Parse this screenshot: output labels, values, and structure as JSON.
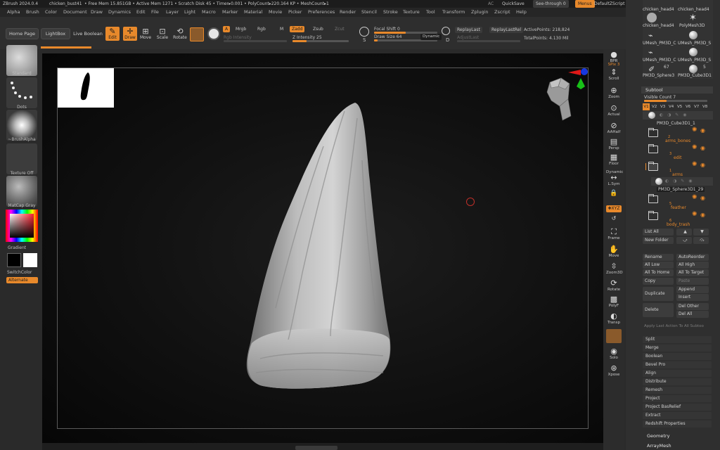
{
  "titlebar": {
    "app": "ZBrush 2024.0.4",
    "file": "chicken_bust41",
    "stats": "• Free Mem 15.851GB • Active Mem 1271 • Scratch Disk 45 • Timer▸0.001 • PolyCount▸220.164 KP • MeshCount▸1",
    "ac": "AC",
    "quicksave": "QuickSave",
    "see_through": "See-through   0",
    "menus": "Menus",
    "zscript": "DefaultZScript"
  },
  "menubar": [
    "Alpha",
    "Brush",
    "Color",
    "Document",
    "Draw",
    "Dynamics",
    "Edit",
    "File",
    "Layer",
    "Light",
    "Macro",
    "Marker",
    "Material",
    "Movie",
    "Picker",
    "Preferences",
    "Render",
    "Stencil",
    "Stroke",
    "Texture",
    "Tool",
    "Transform",
    "Zplugin",
    "Zscript",
    "Help"
  ],
  "toolbar": {
    "home_page": "Home Page",
    "lightbox": "LightBox",
    "live_boolean": "Live Boolean",
    "edit": "Edit",
    "draw": "Draw",
    "move": "Move",
    "scale": "Scale",
    "rotate": "Rotate",
    "a": "A",
    "mrgb": "Mrgb",
    "rgb": "Rgb",
    "m": "M",
    "zadd": "Zadd",
    "zsub": "Zsub",
    "zcut": "Zcut",
    "rgb_intensity": "Rgb Intensity",
    "z_intensity": "Z Intensity 25",
    "focal_shift": "Focal Shift 0",
    "draw_size": "Draw Size 64",
    "dynamic": "Dynamic",
    "replay_last": "ReplayLast",
    "replay_last_rel": "ReplayLastRel",
    "adjust_last": "AdjustLast",
    "active_points": "ActivePoints: 218,824",
    "total_points": "TotalPoints: 4.130 Mil",
    "s": "S",
    "d": "D",
    "z_intensity_level": 0.25,
    "focal_shift_level": 0.5,
    "draw_size_level": 0.06
  },
  "leftshelf": {
    "standard": "Standard",
    "dots": "Dots",
    "brush_alpha": "~BrushAlpha",
    "texture_off": "Texture Off",
    "matcap": "MatCap Gray",
    "gradient": "Gradient",
    "switch_color": "SwitchColor",
    "alternate": "Alternate"
  },
  "rightshelf": {
    "bpr": "BPR",
    "spix": "SPix 3",
    "scroll": "Scroll",
    "zoom": "Zoom",
    "actual": "Actual",
    "aahalf": "AAHalf",
    "persp": "Persp",
    "floor": "Floor",
    "dynamic": "Dynamic",
    "lsym": "L.Sym",
    "xyz": "✚XYZ",
    "frame": "Frame",
    "move": "Move",
    "zoom3d": "Zoom3D",
    "rotate": "Rotate",
    "polyf": "PolyF",
    "transp": "Transp",
    "solo": "Solo",
    "xpose": "Xpose"
  },
  "rightpanel": {
    "tools": [
      {
        "label": "chicken_head4",
        "icon": "head-thumb"
      },
      {
        "label": "chicken_head4",
        "icon": "head-thumb"
      },
      {
        "label": "chicken_head4",
        "icon": "head-thumb"
      },
      {
        "label": "PolyMesh3D",
        "icon": "star-thumb"
      },
      {
        "label": "UMesh_PM3D_C",
        "icon": "mesh-thumb"
      },
      {
        "label": "UMesh_PM3D_S",
        "icon": "sphere-thumb"
      },
      {
        "label": "UMesh_PM3D_C",
        "icon": "mesh-thumb"
      },
      {
        "label": "UMesh_PM3D_S",
        "icon": "sphere-thumb"
      },
      {
        "label": "PM3D_Sphere3",
        "icon": "brush-thumb",
        "count": "67"
      },
      {
        "label": "PM3D_Cube3D1",
        "icon": "cube-thumb",
        "count": "5"
      }
    ],
    "subtool_title": "Subtool",
    "visible_count": "Visible Count 7",
    "visible_count_level": 0.35,
    "versions": [
      "V1",
      "V2",
      "V3",
      "V4",
      "V5",
      "V6",
      "V7",
      "V8"
    ],
    "subtools": [
      {
        "name": "PM3D_Cube3D1_1",
        "num": "",
        "kind": "item"
      },
      {
        "name": "arms_bones",
        "num": "2",
        "kind": "folder"
      },
      {
        "name": "edit",
        "num": "3",
        "kind": "folder"
      },
      {
        "name": "arms",
        "num": "1",
        "kind": "folder"
      },
      {
        "name": "PM3D_Sphere3D1_29",
        "num": "",
        "kind": "item"
      },
      {
        "name": "feather",
        "num": "5",
        "kind": "folder"
      },
      {
        "name": "body_trash",
        "num": "6",
        "kind": "folder"
      }
    ],
    "list_all": "List All",
    "new_folder": "New Folder",
    "rename": "Rename",
    "auto_reorder": "AutoReorder",
    "all_low": "All Low",
    "all_high": "All High",
    "all_to_home": "All To Home",
    "all_to_target": "All To Target",
    "copy": "Copy",
    "paste": "Paste",
    "duplicate": "Duplicate",
    "append": "Append",
    "insert": "Insert",
    "delete": "Delete",
    "del_other": "Del Other",
    "del_all": "Del All",
    "apply_last": "Apply Last Action To All Subtoo",
    "actions": [
      "Split",
      "Merge",
      "Boolean",
      "Bevel Pro",
      "Align",
      "Distribute",
      "Remesh",
      "Project",
      "Project BasRelief",
      "Extract",
      "Redshift Properties"
    ],
    "geometry": "Geometry",
    "arraymesh": "ArrayMesh"
  }
}
